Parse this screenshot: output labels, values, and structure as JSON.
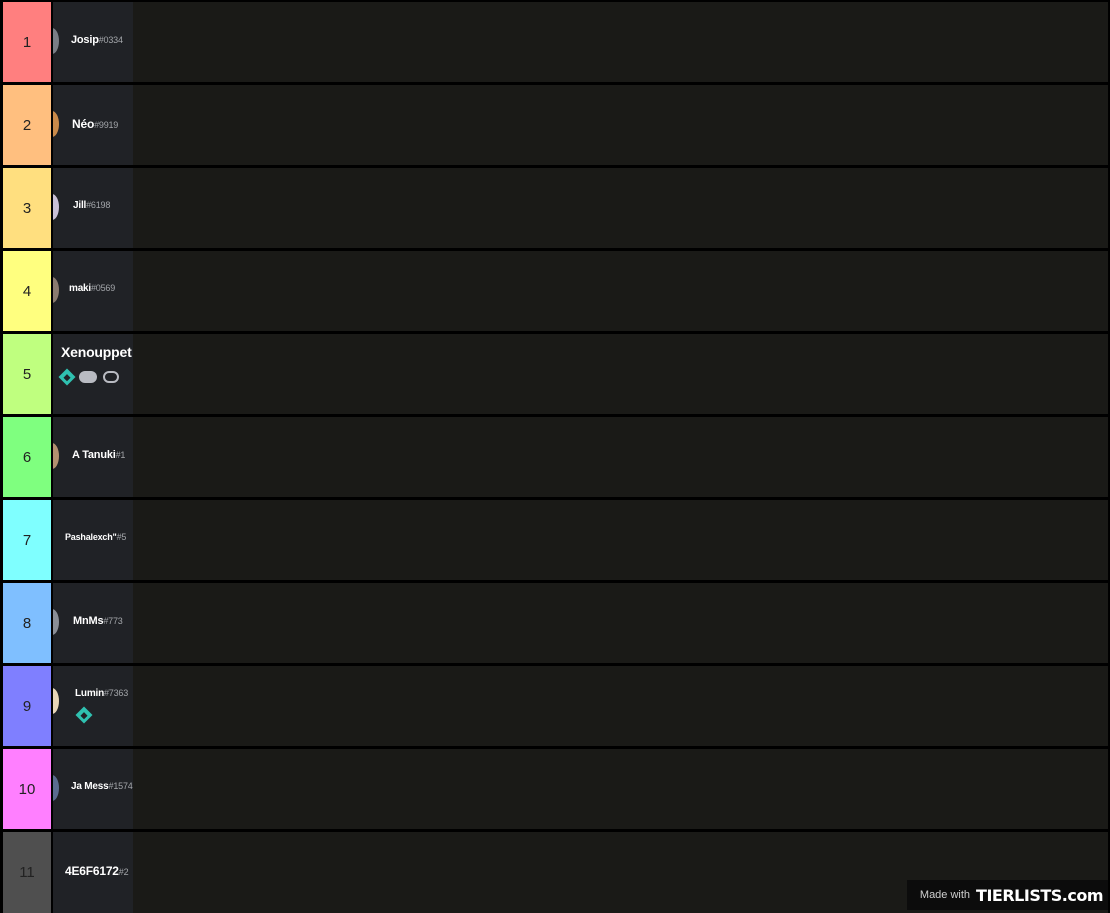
{
  "tiers": [
    {
      "label": "1",
      "color": "#ff7f7f",
      "name": "Josip",
      "disc": "#0334",
      "avatar": "#7a7e86"
    },
    {
      "label": "2",
      "color": "#ffbf7f",
      "name": "Néo",
      "disc": "#9919",
      "avatar": "#c98a4a"
    },
    {
      "label": "3",
      "color": "#ffdf7f",
      "name": "Jill",
      "disc": "#6198",
      "avatar": "#c9c0d6"
    },
    {
      "label": "4",
      "color": "#ffff7f",
      "name": "maki",
      "disc": "#0569",
      "avatar": "#8b7b70"
    },
    {
      "label": "5",
      "color": "#bfff7f",
      "name": "Xenouppet",
      "disc": "",
      "avatar": ""
    },
    {
      "label": "6",
      "color": "#7fff7f",
      "name": "A Tanuki",
      "disc": "#1",
      "avatar": "#b39070"
    },
    {
      "label": "7",
      "color": "#7fffff",
      "name": "Pashalexch\"",
      "disc": "#5",
      "avatar": ""
    },
    {
      "label": "8",
      "color": "#7fbfff",
      "name": "MnMs",
      "disc": "#773",
      "avatar": "#8a8e96"
    },
    {
      "label": "9",
      "color": "#7f7fff",
      "name": "Lumin",
      "disc": "#7363",
      "avatar": "#e8d6b8"
    },
    {
      "label": "10",
      "color": "#ff7fff",
      "name": "Ja Mess",
      "disc": "#1574",
      "avatar": "#5a6c90"
    },
    {
      "label": "11",
      "color": "#4f4f4f",
      "name": "4E6F6172",
      "disc": "#2",
      "avatar": ""
    }
  ],
  "watermark": {
    "made_with": "Made with",
    "brand": "TIERLISTS.com"
  }
}
